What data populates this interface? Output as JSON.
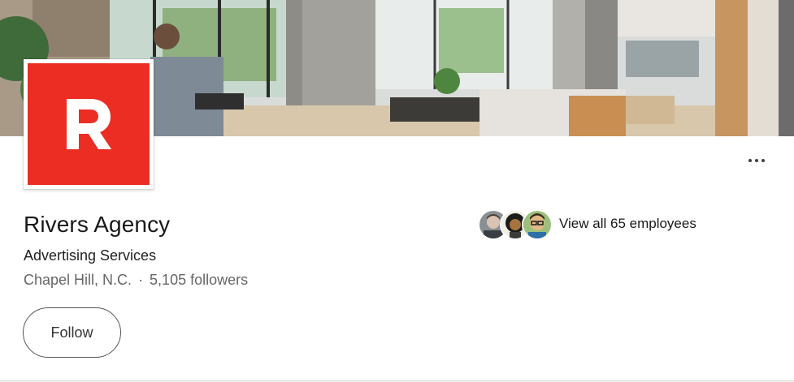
{
  "company": {
    "logo_letter": "R",
    "logo_color": "#ec2d24",
    "name": "Rivers Agency",
    "industry": "Advertising Services",
    "location": "Chapel Hill, N.C.",
    "separator": "·",
    "followers": "5,105 followers"
  },
  "actions": {
    "follow_label": "Follow",
    "more_icon": "ellipsis-icon"
  },
  "employees": {
    "link_label": "View all 65 employees",
    "avatar_count": 3
  }
}
